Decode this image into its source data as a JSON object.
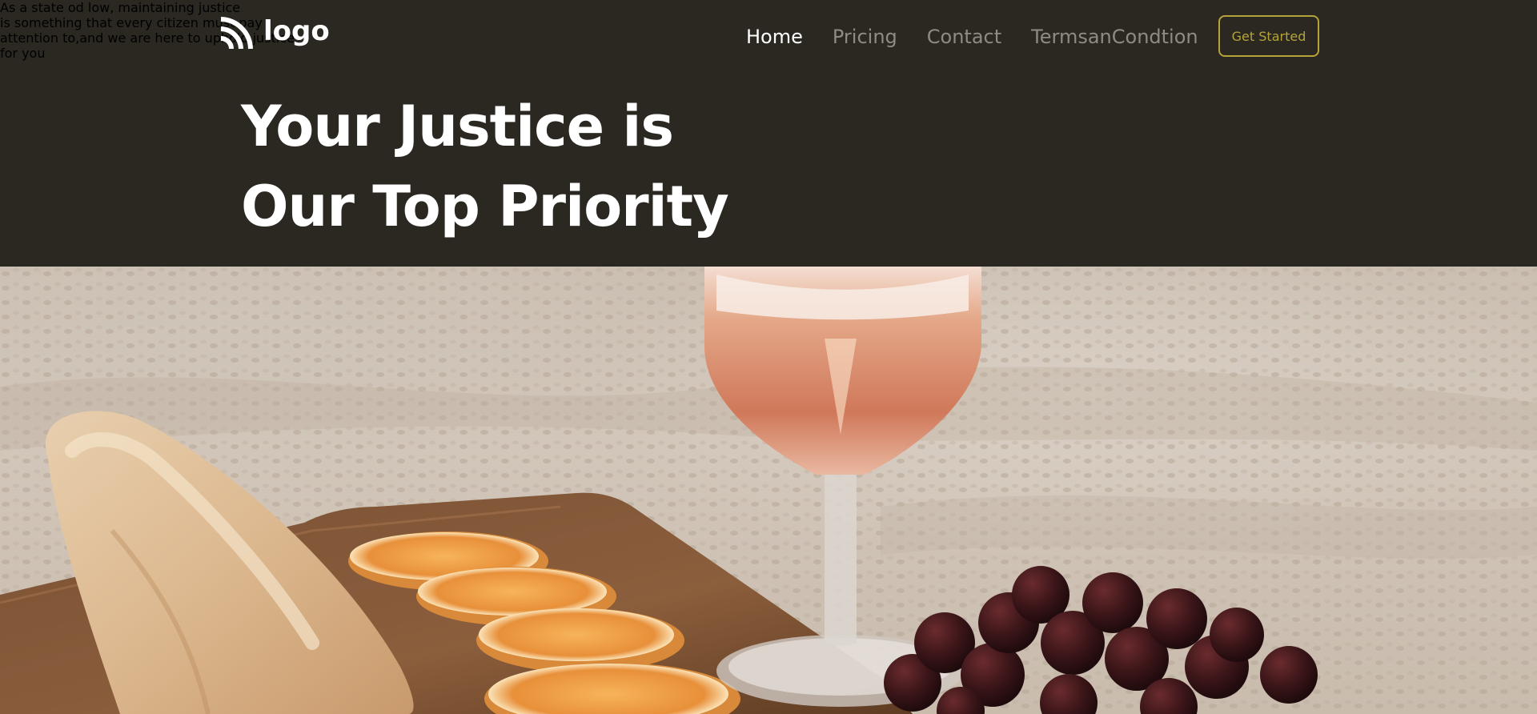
{
  "header": {
    "logo_text": "logo",
    "logo_icon": "wifi-arcs-logo-icon",
    "nav": [
      {
        "label": "Home",
        "active": true
      },
      {
        "label": "Pricing",
        "active": false
      },
      {
        "label": "Contact",
        "active": false
      },
      {
        "label": "TermsanCondtion",
        "active": false
      }
    ],
    "cta_label": "Get Started"
  },
  "hero": {
    "headline_line1": "Your Justice is",
    "headline_line2": "Our Top Priority",
    "blurb_lines": [
      "As a state od low, maintaining justice",
      "is something that every citizen must pay",
      "attention to,and we are here to uphold justice",
      "for you"
    ]
  },
  "colors": {
    "background": "#2b2822",
    "accent": "#b5a33a",
    "nav_inactive": "#8f8b83",
    "text_primary": "#ffffff"
  }
}
